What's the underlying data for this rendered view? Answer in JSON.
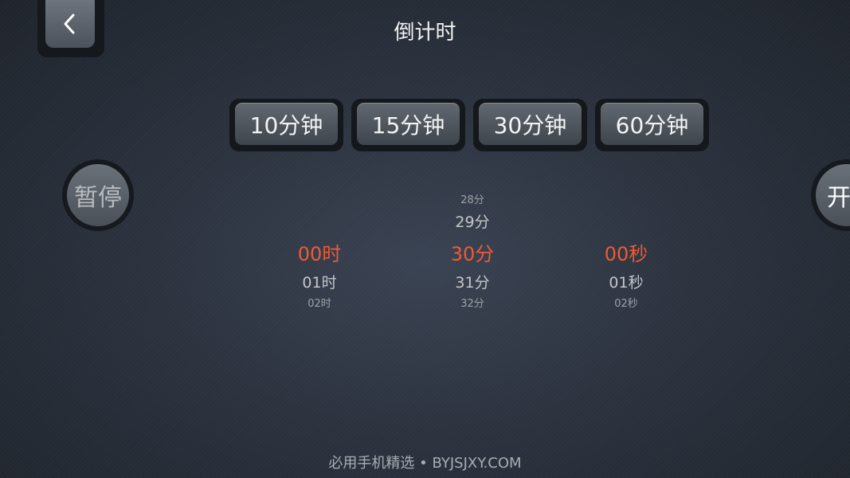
{
  "header": {
    "title": "倒计时"
  },
  "presets": [
    "10分钟",
    "15分钟",
    "30分钟",
    "60分钟"
  ],
  "controls": {
    "pause_label": "暂停",
    "start_label": "开始"
  },
  "picker": {
    "hours": {
      "far_above": "",
      "above": "",
      "selected": "00时",
      "below": "01时",
      "far_below": "02时"
    },
    "minutes": {
      "far_above": "28分",
      "above": "29分",
      "selected": "30分",
      "below": "31分",
      "far_below": "32分"
    },
    "seconds": {
      "far_above": "",
      "above": "",
      "selected": "00秒",
      "below": "01秒",
      "far_below": "02秒"
    }
  },
  "watermark": "必用手机精选 • BYJSJXY.COM",
  "colors": {
    "selected": "#ee5a35",
    "background": "#2c333f"
  }
}
